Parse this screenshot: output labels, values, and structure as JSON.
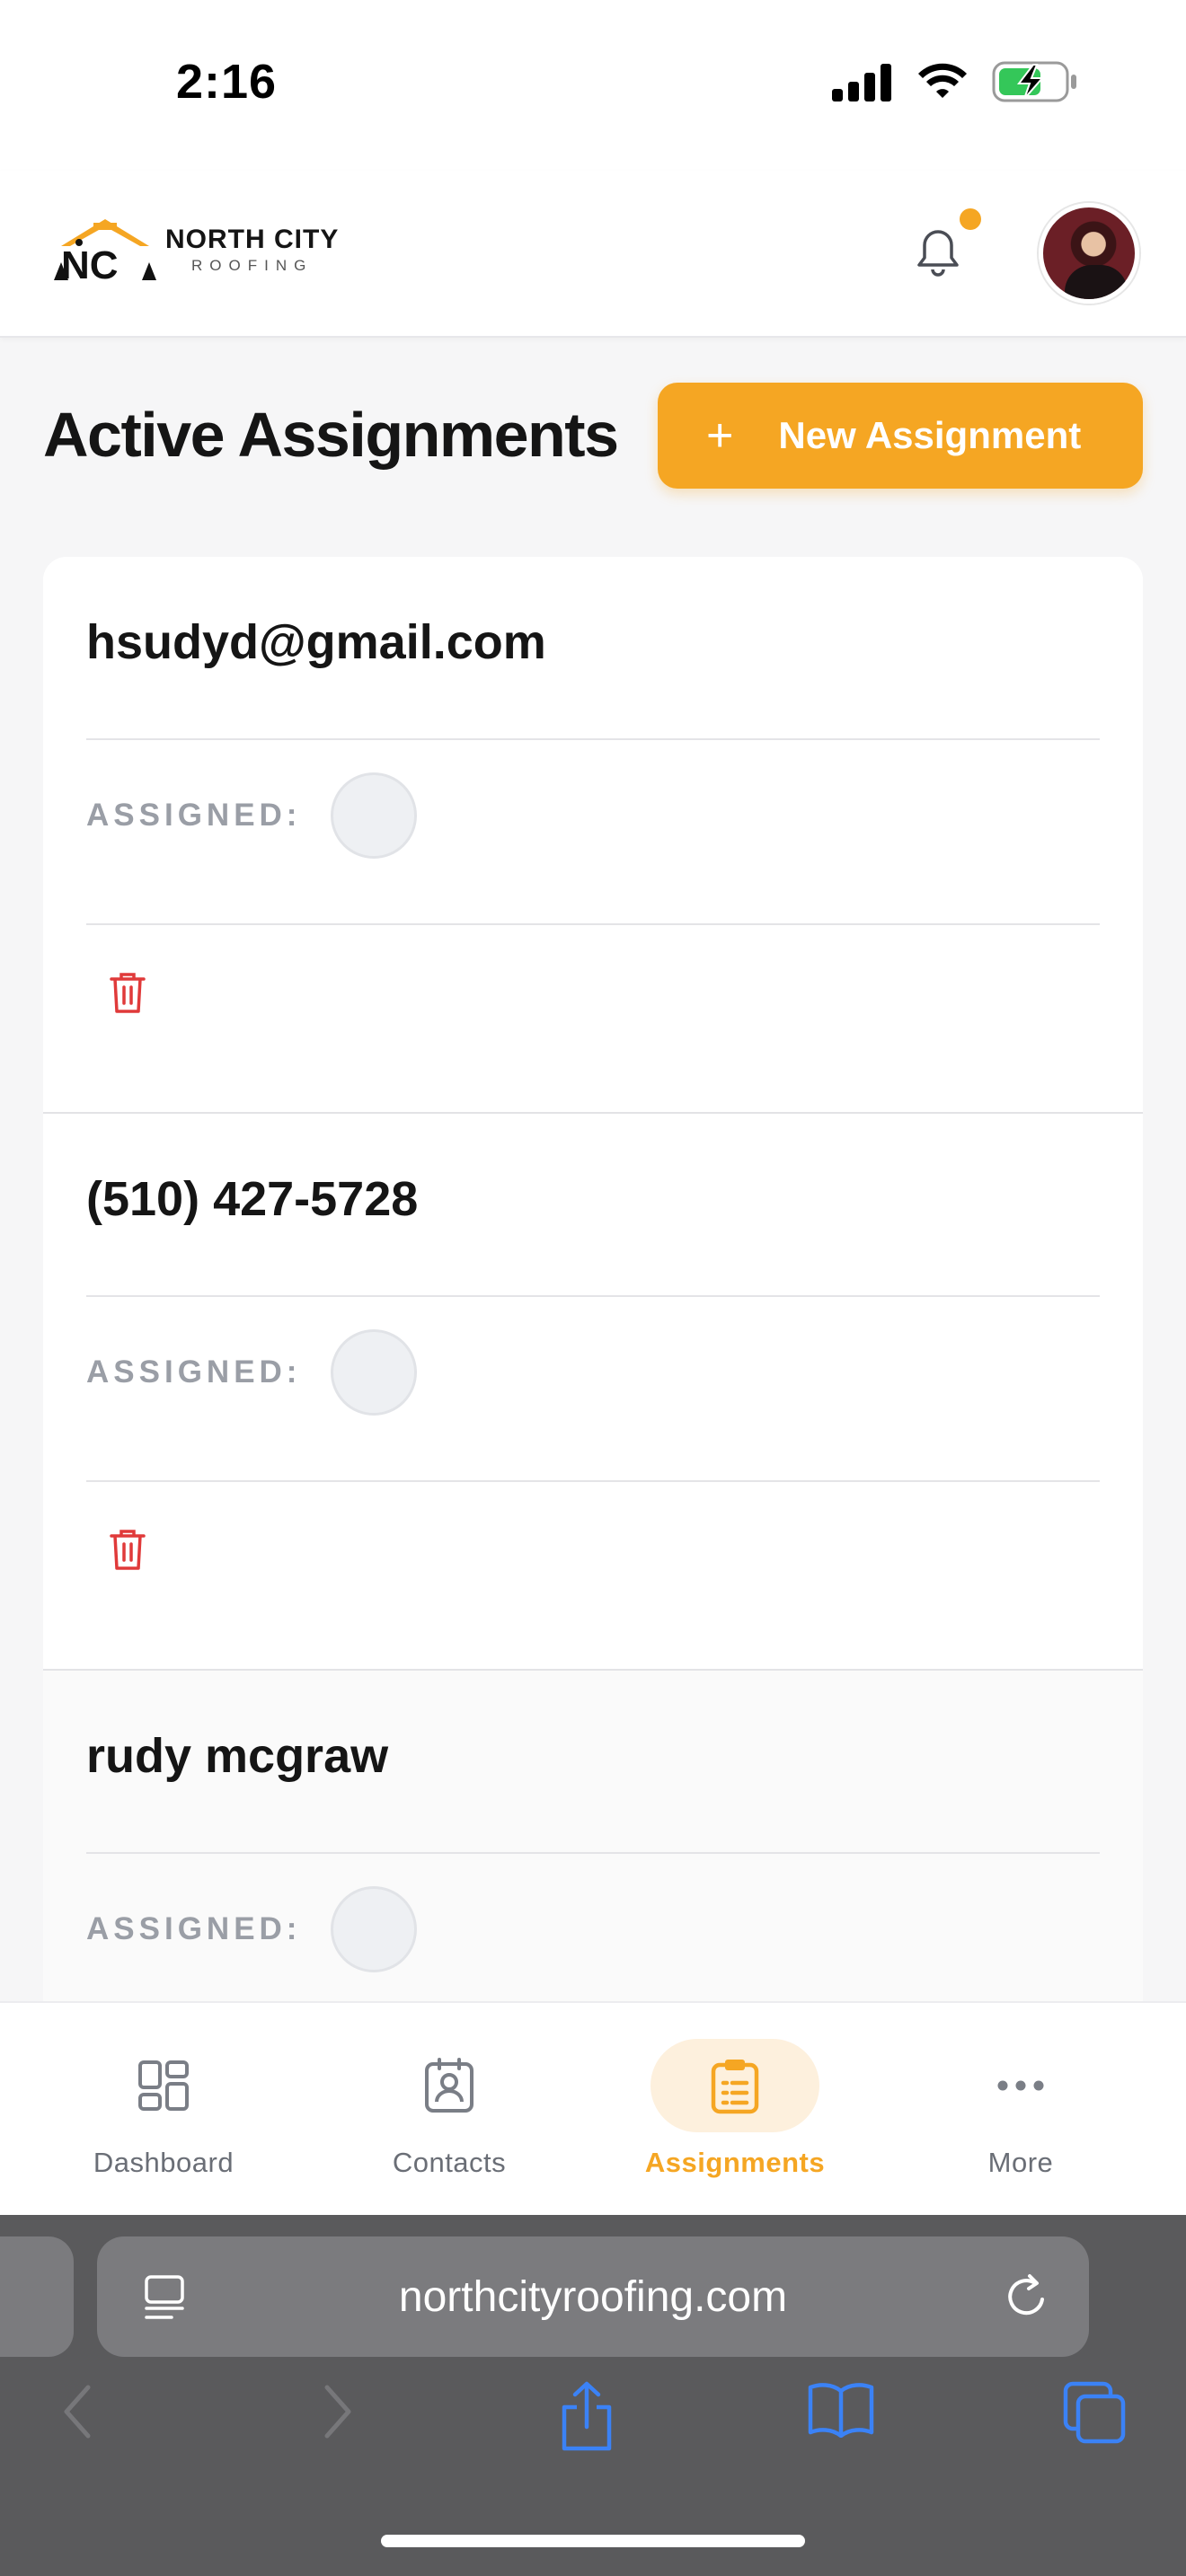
{
  "status_bar": {
    "time": "2:16"
  },
  "header": {
    "brand_name": "NORTH CITY",
    "brand_sub": "ROOFING",
    "has_notification": true
  },
  "page": {
    "title": "Active Assignments",
    "new_button_label": "New Assignment"
  },
  "assignments": [
    {
      "title": "hsudyd@gmail.com",
      "assigned_label": "ASSIGNED:"
    },
    {
      "title": "(510) 427-5728",
      "assigned_label": "ASSIGNED:"
    },
    {
      "title": "rudy mcgraw",
      "assigned_label": "ASSIGNED:"
    }
  ],
  "tabbar": {
    "tabs": [
      {
        "label": "Dashboard",
        "icon": "dashboard-icon",
        "active": false
      },
      {
        "label": "Contacts",
        "icon": "contacts-icon",
        "active": false
      },
      {
        "label": "Assignments",
        "icon": "clipboard-icon",
        "active": true
      },
      {
        "label": "More",
        "icon": "more-icon",
        "active": false
      }
    ]
  },
  "browser": {
    "url": "northcityroofing.com"
  },
  "colors": {
    "accent": "#f5a623",
    "danger": "#e03a3a",
    "muted": "#9a9ea6",
    "browser_icon": "#3b82f6"
  }
}
